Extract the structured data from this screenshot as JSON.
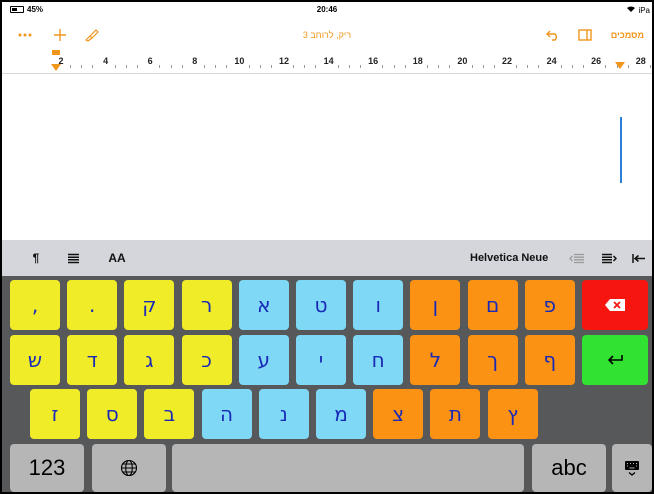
{
  "status_bar": {
    "battery": "45%",
    "time": "20:46",
    "carrier": "iPa"
  },
  "toolbar": {
    "title": "ריק, לרוחב 3",
    "documents_label": "מסמכים"
  },
  "ruler": {
    "numbers": [
      "2",
      "4",
      "6",
      "8",
      "10",
      "12",
      "14",
      "16",
      "18",
      "20",
      "22",
      "24",
      "26",
      "28"
    ]
  },
  "format_bar": {
    "font_name": "Helvetica Neue",
    "text_size_label": "AA"
  },
  "keyboard": {
    "row1": [
      {
        "label": ",",
        "color": "yellow"
      },
      {
        "label": ".",
        "color": "yellow"
      },
      {
        "label": "ק",
        "color": "yellow"
      },
      {
        "label": "ר",
        "color": "yellow"
      },
      {
        "label": "א",
        "color": "cyan"
      },
      {
        "label": "ט",
        "color": "cyan"
      },
      {
        "label": "ו",
        "color": "cyan"
      },
      {
        "label": "ן",
        "color": "orange"
      },
      {
        "label": "ם",
        "color": "orange"
      },
      {
        "label": "פ",
        "color": "orange"
      }
    ],
    "row2": [
      {
        "label": "ש",
        "color": "yellow"
      },
      {
        "label": "ד",
        "color": "yellow"
      },
      {
        "label": "ג",
        "color": "yellow"
      },
      {
        "label": "כ",
        "color": "yellow"
      },
      {
        "label": "ע",
        "color": "cyan"
      },
      {
        "label": "י",
        "color": "cyan"
      },
      {
        "label": "ח",
        "color": "cyan"
      },
      {
        "label": "ל",
        "color": "orange"
      },
      {
        "label": "ך",
        "color": "orange"
      },
      {
        "label": "ף",
        "color": "orange"
      }
    ],
    "row3": [
      {
        "label": "ז",
        "color": "yellow"
      },
      {
        "label": "ס",
        "color": "yellow"
      },
      {
        "label": "ב",
        "color": "yellow"
      },
      {
        "label": "ה",
        "color": "cyan"
      },
      {
        "label": "נ",
        "color": "cyan"
      },
      {
        "label": "מ",
        "color": "cyan"
      },
      {
        "label": "צ",
        "color": "orange"
      },
      {
        "label": "ת",
        "color": "orange"
      },
      {
        "label": "ץ",
        "color": "orange"
      }
    ],
    "numbers_label": "123",
    "abc_label": "abc"
  },
  "colors": {
    "accent": "#f0961c",
    "yellow": "#f0ec27",
    "cyan": "#7fd8f5",
    "orange": "#fb9213",
    "backspace": "#f6160f",
    "return": "#31e231",
    "key_text": "#1a2ab8"
  }
}
